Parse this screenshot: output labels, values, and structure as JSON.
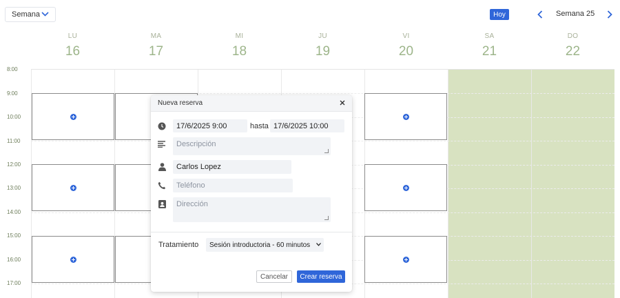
{
  "toolbar": {
    "view_label": "Semana",
    "today_label": "Hoy",
    "week_label": "Semana 25"
  },
  "days": [
    {
      "name": "LU",
      "num": "16"
    },
    {
      "name": "MA",
      "num": "17"
    },
    {
      "name": "MI",
      "num": "18"
    },
    {
      "name": "JU",
      "num": "19"
    },
    {
      "name": "VI",
      "num": "20"
    },
    {
      "name": "SA",
      "num": "21"
    },
    {
      "name": "DO",
      "num": "22"
    }
  ],
  "hours": [
    "8:00",
    "9:00",
    "10:00",
    "11:00",
    "12:00",
    "13:00",
    "14:00",
    "15:00",
    "16:00",
    "17:00"
  ],
  "modal": {
    "title": "Nueva reserva",
    "start": "17/6/2025  9:00",
    "until_label": "hasta",
    "end": "17/6/2025  10:00",
    "description_placeholder": "Descripción",
    "client_name": "Carlos Lopez",
    "phone_placeholder": "Teléfono",
    "address_placeholder": "Dirección",
    "treatment_label": "Tratamiento",
    "treatment_value": "Sesión introductoria - 60 minutos",
    "cancel_label": "Cancelar",
    "create_label": "Crear reserva"
  },
  "colors": {
    "accent": "#2f66d9",
    "weekend": "#d8e2c1",
    "day_header": "#9db58a"
  }
}
